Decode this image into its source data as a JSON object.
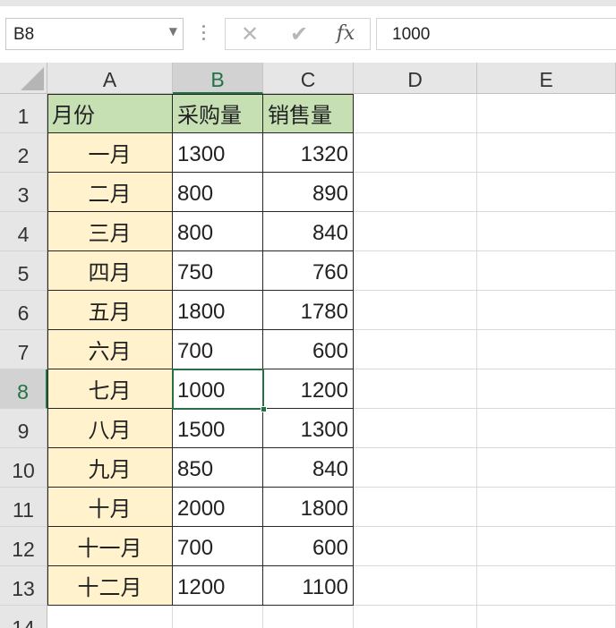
{
  "name_box": {
    "value": "B8"
  },
  "formula_bar": {
    "value": "1000",
    "fx_label": "fx"
  },
  "columns": [
    "A",
    "B",
    "C",
    "D",
    "E"
  ],
  "rows": [
    "1",
    "2",
    "3",
    "4",
    "5",
    "6",
    "7",
    "8",
    "9",
    "10",
    "11",
    "12",
    "13",
    "14"
  ],
  "selected": {
    "column": "B",
    "row": "8"
  },
  "table": {
    "headers": [
      "月份",
      "采购量",
      "销售量"
    ],
    "data": [
      [
        "一月",
        "1300",
        "1320"
      ],
      [
        "二月",
        "800",
        "890"
      ],
      [
        "三月",
        "800",
        "840"
      ],
      [
        "四月",
        "750",
        "760"
      ],
      [
        "五月",
        "1800",
        "1780"
      ],
      [
        "六月",
        "700",
        "600"
      ],
      [
        "七月",
        "1000",
        "1200"
      ],
      [
        "八月",
        "1500",
        "1300"
      ],
      [
        "九月",
        "850",
        "840"
      ],
      [
        "十月",
        "2000",
        "1800"
      ],
      [
        "十一月",
        "700",
        "600"
      ],
      [
        "十二月",
        "1200",
        "1100"
      ]
    ]
  },
  "colors": {
    "header_fill": "#c6e0b4",
    "month_fill": "#fff2cc",
    "selection": "#217346"
  }
}
